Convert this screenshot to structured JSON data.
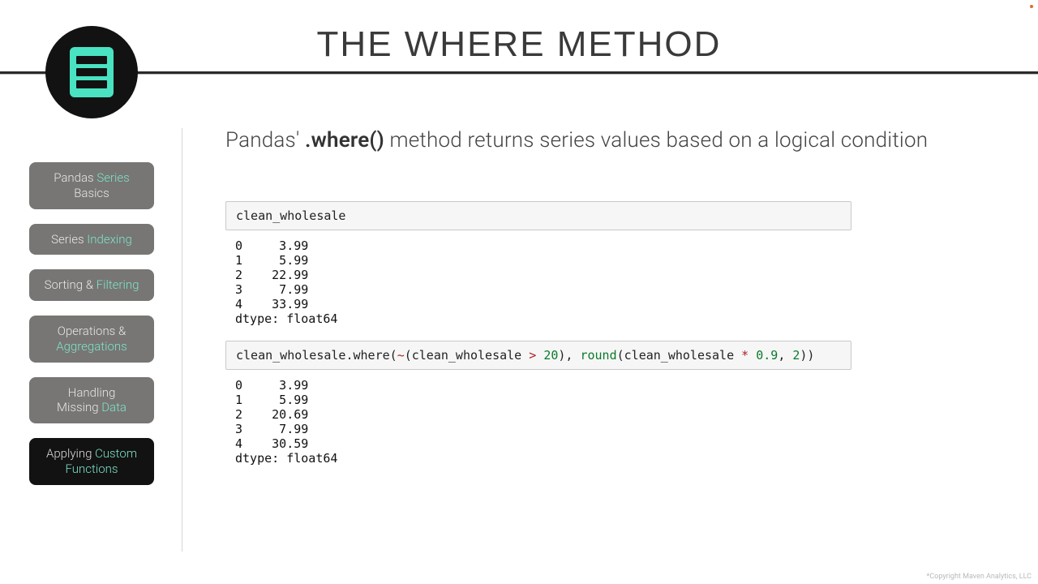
{
  "header": {
    "title": "THE WHERE METHOD"
  },
  "sidebar": {
    "items": [
      {
        "line1": "Pandas ",
        "accent1": "Series",
        "line2": "Basics",
        "accent2": ""
      },
      {
        "line1": "Series ",
        "accent1": "Indexing",
        "line2": "",
        "accent2": ""
      },
      {
        "line1": "Sorting & ",
        "accent1": "Filtering",
        "line2": "",
        "accent2": ""
      },
      {
        "line1": "Operations &",
        "accent1": "",
        "line2": "",
        "accent2": "Aggregations"
      },
      {
        "line1": "Handling",
        "accent1": "",
        "line2": "Missing ",
        "accent2": "Data"
      },
      {
        "line1": "Applying ",
        "accent1": "Custom",
        "line2": "",
        "accent2": "Functions"
      }
    ],
    "active_index": 5
  },
  "lead": {
    "prefix": "Pandas' ",
    "method": ".where()",
    "suffix": " method returns series values based on a logical condition"
  },
  "block1": {
    "code": "clean_wholesale",
    "output": "0     3.99\n1     5.99\n2    22.99\n3     7.99\n4    33.99\ndtype: float64"
  },
  "block2": {
    "code": {
      "p1": "clean_wholesale.where(",
      "op": "~",
      "p2": "(clean_wholesale ",
      "cmp": ">",
      "p3": " ",
      "n1": "20",
      "p4": "), ",
      "fn": "round",
      "p5": "(clean_wholesale ",
      "mul": "*",
      "p6": " ",
      "n2": "0.9",
      "p7": ", ",
      "n3": "2",
      "p8": "))"
    },
    "output": "0     3.99\n1     5.99\n2    20.69\n3     7.99\n4    30.59\ndtype: float64"
  },
  "footer": "*Copyright Maven Analytics, LLC"
}
